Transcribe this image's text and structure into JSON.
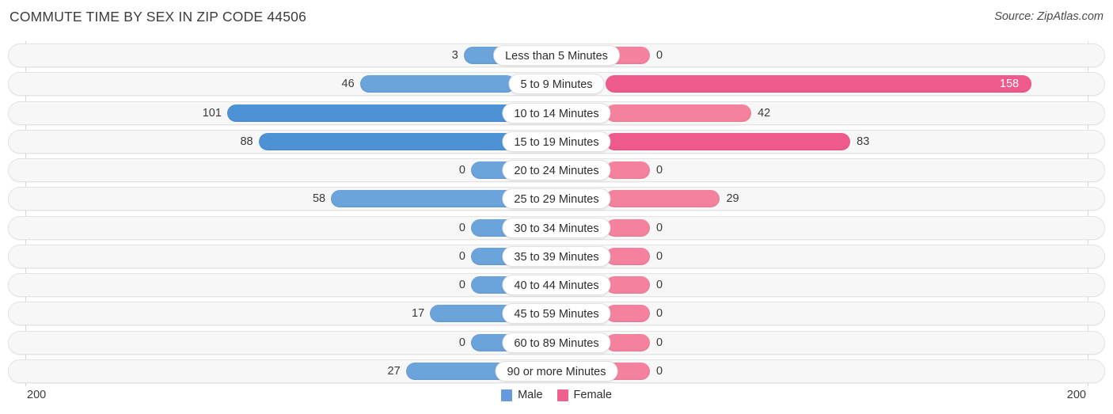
{
  "header": {
    "title": "COMMUTE TIME BY SEX IN ZIP CODE 44506",
    "source": "Source: ZipAtlas.com"
  },
  "axis": {
    "left_label": "200",
    "right_label": "200",
    "max": 200
  },
  "legend": {
    "items": [
      {
        "label": "Male",
        "color": "#6699dd"
      },
      {
        "label": "Female",
        "color": "#f0608f"
      }
    ]
  },
  "colors": {
    "male_bar": "#6ba3db",
    "female_bar": "#f4829f",
    "male_bar_strong": "#4e92d6",
    "female_bar_strong": "#ee5a8b",
    "track": "#f7f7f7",
    "track_border": "#e3e3e3"
  },
  "chart_data": {
    "type": "bar",
    "title": "COMMUTE TIME BY SEX IN ZIP CODE 44506",
    "subtitle": "",
    "xlabel": "",
    "ylabel": "",
    "orientation": "horizontal-diverging",
    "grid": false,
    "legend_position": "bottom-center",
    "axis_max": 200,
    "axis_tick_labels": [
      "200",
      "200"
    ],
    "categories": [
      "Less than 5 Minutes",
      "5 to 9 Minutes",
      "10 to 14 Minutes",
      "15 to 19 Minutes",
      "20 to 24 Minutes",
      "25 to 29 Minutes",
      "30 to 34 Minutes",
      "35 to 39 Minutes",
      "40 to 44 Minutes",
      "45 to 59 Minutes",
      "60 to 89 Minutes",
      "90 or more Minutes"
    ],
    "series": [
      {
        "name": "Male",
        "values": [
          3,
          46,
          101,
          88,
          0,
          58,
          0,
          0,
          0,
          17,
          0,
          27
        ]
      },
      {
        "name": "Female",
        "values": [
          0,
          158,
          42,
          83,
          0,
          29,
          0,
          0,
          0,
          0,
          0,
          0
        ]
      }
    ]
  },
  "rows": [
    {
      "label": "Less than 5 Minutes",
      "male": "3",
      "female": "0"
    },
    {
      "label": "5 to 9 Minutes",
      "male": "46",
      "female": "158"
    },
    {
      "label": "10 to 14 Minutes",
      "male": "101",
      "female": "42"
    },
    {
      "label": "15 to 19 Minutes",
      "male": "88",
      "female": "83"
    },
    {
      "label": "20 to 24 Minutes",
      "male": "0",
      "female": "0"
    },
    {
      "label": "25 to 29 Minutes",
      "male": "58",
      "female": "29"
    },
    {
      "label": "30 to 34 Minutes",
      "male": "0",
      "female": "0"
    },
    {
      "label": "35 to 39 Minutes",
      "male": "0",
      "female": "0"
    },
    {
      "label": "40 to 44 Minutes",
      "male": "0",
      "female": "0"
    },
    {
      "label": "45 to 59 Minutes",
      "male": "17",
      "female": "0"
    },
    {
      "label": "60 to 89 Minutes",
      "male": "0",
      "female": "0"
    },
    {
      "label": "90 or more Minutes",
      "male": "27",
      "female": "0"
    }
  ]
}
